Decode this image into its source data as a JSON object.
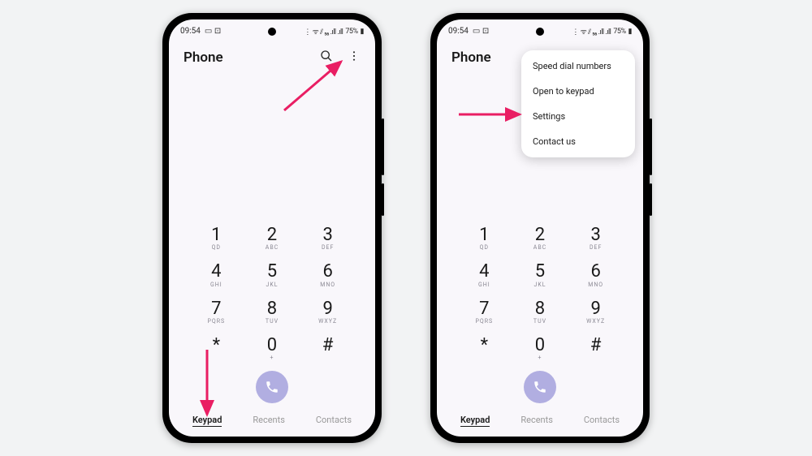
{
  "status": {
    "time": "09:54",
    "icons_left": "▭ ⊡",
    "icons_right": "⋮ ᯤ ⫽ ₅₆ .ıll .ıll",
    "battery": "75%"
  },
  "appbar": {
    "title": "Phone"
  },
  "keypad": {
    "keys": [
      {
        "num": "1",
        "sub": "QD"
      },
      {
        "num": "2",
        "sub": "ABC"
      },
      {
        "num": "3",
        "sub": "DEF"
      },
      {
        "num": "4",
        "sub": "GHI"
      },
      {
        "num": "5",
        "sub": "JKL"
      },
      {
        "num": "6",
        "sub": "MNO"
      },
      {
        "num": "7",
        "sub": "PQRS"
      },
      {
        "num": "8",
        "sub": "TUV"
      },
      {
        "num": "9",
        "sub": "WXYZ"
      },
      {
        "num": "*",
        "sub": ""
      },
      {
        "num": "0",
        "sub": "+"
      },
      {
        "num": "#",
        "sub": ""
      }
    ]
  },
  "tabs": {
    "items": [
      {
        "label": "Keypad",
        "active": true
      },
      {
        "label": "Recents",
        "active": false
      },
      {
        "label": "Contacts",
        "active": false
      }
    ]
  },
  "menu": {
    "items": [
      {
        "label": "Speed dial numbers"
      },
      {
        "label": "Open to keypad"
      },
      {
        "label": "Settings"
      },
      {
        "label": "Contact us"
      }
    ]
  },
  "annotation": {
    "color": "#e91e63"
  }
}
